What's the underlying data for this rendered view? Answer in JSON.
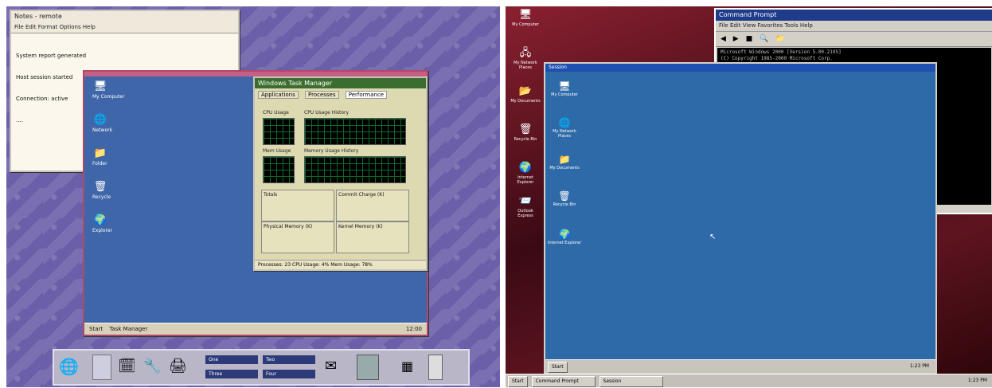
{
  "left": {
    "note": {
      "title": "Notes - remote",
      "menu": "File  Edit  Format  Options  Help",
      "lines": [
        "System report generated",
        "Host session started",
        "Connection: active",
        "...."
      ]
    },
    "xdesk": {
      "icons": [
        {
          "label": "My Computer",
          "name": "my-computer-icon",
          "glyph": "🖥"
        },
        {
          "label": "Network",
          "name": "network-icon",
          "glyph": "🌐"
        },
        {
          "label": "Folder",
          "name": "folder-icon",
          "glyph": "📁"
        },
        {
          "label": "Recycle",
          "name": "recycle-bin-icon",
          "glyph": "🗑"
        },
        {
          "label": "Explorer",
          "name": "internet-explorer-icon",
          "glyph": "🌍"
        }
      ],
      "taskbar": {
        "start": "Start",
        "item": "Task Manager",
        "clock": "12:00"
      }
    },
    "taskmgr": {
      "title": "Windows Task Manager",
      "tabs": [
        "Applications",
        "Processes",
        "Performance"
      ],
      "cpu_label": "CPU Usage",
      "cpu_hist_label": "CPU Usage History",
      "mem_label": "Mem Usage",
      "mem_hist_label": "Memory Usage History",
      "totals": "Totals",
      "commit": "Commit Charge (K)",
      "physical": "Physical Memory (K)",
      "kernel": "Kernel Memory (K)",
      "status": "Processes: 23   CPU Usage: 4%   Mem Usage: 78%"
    },
    "cde": {
      "ws": [
        "One",
        "Two",
        "Three",
        "Four"
      ]
    }
  },
  "right": {
    "cmd": {
      "title": "Command Prompt",
      "menu": "File  Edit  View  Favorites  Tools  Help",
      "console": "Microsoft Windows 2000 [Version 5.00.2195]\n(C) Copyright 1985-2000 Microsoft Corp."
    },
    "desktop_icons": [
      {
        "label": "My Computer",
        "name": "my-computer-icon",
        "glyph": "🖥"
      },
      {
        "label": "My Network Places",
        "name": "network-places-icon",
        "glyph": "🖧"
      },
      {
        "label": "My Documents",
        "name": "my-documents-icon",
        "glyph": "📂"
      },
      {
        "label": "Recycle Bin",
        "name": "recycle-bin-icon",
        "glyph": "🗑"
      },
      {
        "label": "Internet Explorer",
        "name": "internet-explorer-icon",
        "glyph": "🌍"
      },
      {
        "label": "Outlook Express",
        "name": "outlook-express-icon",
        "glyph": "📨"
      }
    ],
    "rdp": {
      "title": "Session",
      "icons": [
        {
          "label": "My Computer",
          "name": "my-computer-icon",
          "glyph": "🖥"
        },
        {
          "label": "My Network Places",
          "name": "network-places-icon",
          "glyph": "🌐"
        },
        {
          "label": "My Documents",
          "name": "my-documents-icon",
          "glyph": "📁"
        },
        {
          "label": "Recycle Bin",
          "name": "recycle-bin-icon",
          "glyph": "🗑"
        },
        {
          "label": "Internet Explorer",
          "name": "internet-explorer-icon",
          "glyph": "🌍"
        }
      ],
      "taskbar_start": "Start",
      "clock": "1:23 PM"
    },
    "taskbar": {
      "start": "Start",
      "items": [
        "Command Prompt",
        "Session"
      ],
      "clock": "1:23 PM"
    }
  }
}
